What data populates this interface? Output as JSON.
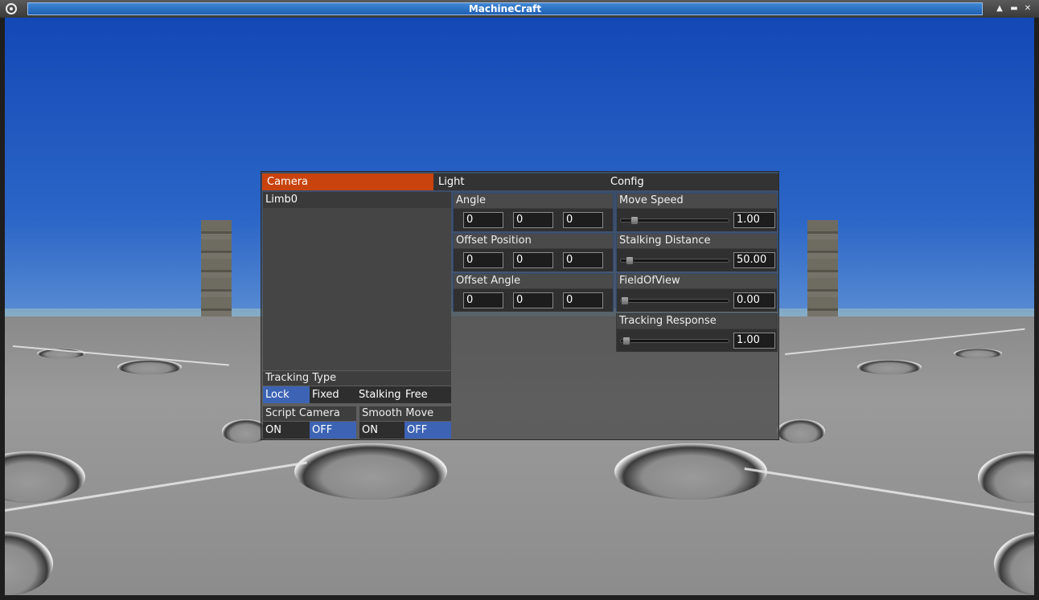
{
  "window": {
    "title": "MachineCraft",
    "controls": [
      "▲",
      "▬",
      "✕"
    ]
  },
  "panel": {
    "tabs": [
      {
        "label": "Camera",
        "active": true
      },
      {
        "label": "Light",
        "active": false
      },
      {
        "label": "Config",
        "active": false
      }
    ],
    "limb_list": {
      "header": "Limb0"
    },
    "tracking_type": {
      "label": "Tracking Type",
      "options": [
        "Lock",
        "Fixed",
        "Stalking",
        "Free"
      ],
      "selected": "Lock"
    },
    "script_camera": {
      "label": "Script Camera",
      "on": "ON",
      "off": "OFF",
      "selected": "OFF"
    },
    "smooth_move": {
      "label": "Smooth Move",
      "on": "ON",
      "off": "OFF",
      "selected": "OFF"
    },
    "vectors": [
      {
        "label": "Angle",
        "x": "0",
        "y": "0",
        "z": "0"
      },
      {
        "label": "Offset Position",
        "x": "0",
        "y": "0",
        "z": "0"
      },
      {
        "label": "Offset Angle",
        "x": "0",
        "y": "0",
        "z": "0"
      }
    ],
    "sliders": [
      {
        "label": "Move Speed",
        "value": "1.00",
        "level": 0.13
      },
      {
        "label": "Stalking Distance",
        "value": "50.00",
        "level": 0.08
      },
      {
        "label": "FieldOfView",
        "value": "0.00",
        "level": 0.04
      },
      {
        "label": "Tracking Response",
        "value": "1.00",
        "level": 0.05
      }
    ]
  },
  "colors": {
    "tab_active": "#c8430d",
    "selected_option": "#3d63b4",
    "title_bar": "#2f78cf",
    "sky": "#1348b6"
  }
}
